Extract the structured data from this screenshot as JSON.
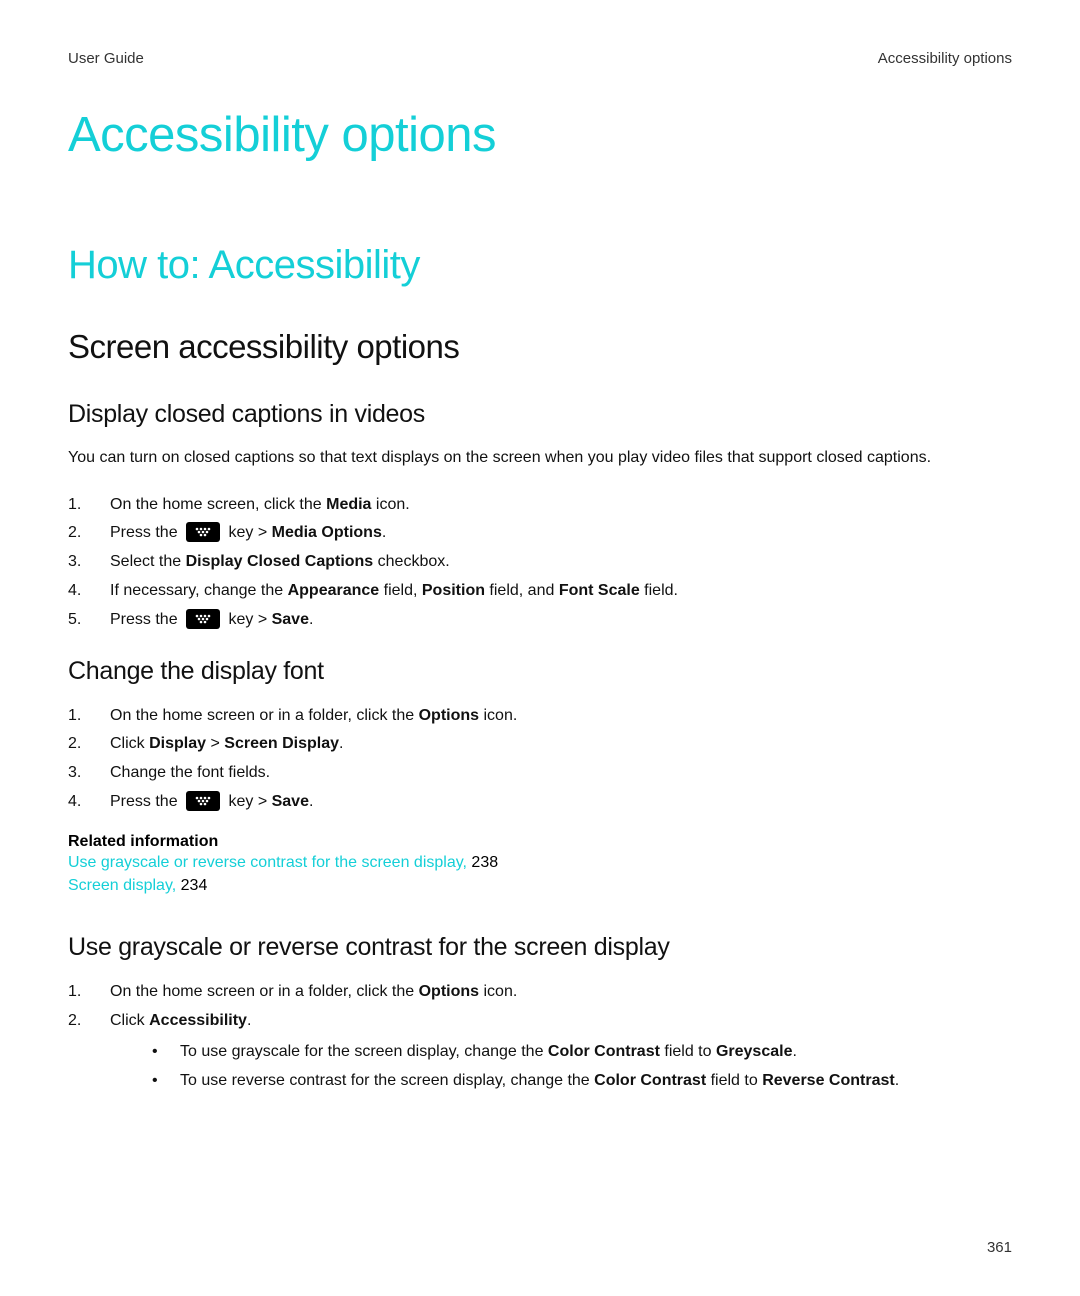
{
  "header": {
    "left": "User Guide",
    "right": "Accessibility options"
  },
  "page_title": "Accessibility options",
  "sections": {
    "howto": {
      "title": "How to: Accessibility",
      "screen_options": {
        "title": "Screen accessibility options",
        "closed_captions": {
          "title": "Display closed captions in videos",
          "intro": "You can turn on closed captions so that text displays on the screen when you play video files that support closed captions.",
          "steps": {
            "s1_a": "On the home screen, click the ",
            "s1_b": "Media",
            "s1_c": " icon.",
            "s2_a": "Press the ",
            "s2_b": " key > ",
            "s2_c": "Media Options",
            "s3_a": "Select the ",
            "s3_b": "Display Closed Captions",
            "s3_c": " checkbox.",
            "s4_a": "If necessary, change the ",
            "s4_b": "Appearance",
            "s4_c": " field, ",
            "s4_d": "Position",
            "s4_e": " field, and ",
            "s4_f": "Font Scale",
            "s4_g": " field.",
            "s5_a": "Press the ",
            "s5_b": " key > ",
            "s5_c": "Save"
          }
        },
        "display_font": {
          "title": "Change the display font",
          "steps": {
            "s1_a": "On the home screen or in a folder, click the ",
            "s1_b": "Options",
            "s1_c": " icon.",
            "s2_a": "Click ",
            "s2_b": "Display",
            "s2_c": " > ",
            "s2_d": "Screen Display",
            "s3": "Change the font fields.",
            "s4_a": "Press the ",
            "s4_b": " key > ",
            "s4_c": "Save"
          },
          "related": {
            "heading": "Related information",
            "link1_text": "Use grayscale or reverse contrast for the screen display,",
            "link1_page": " 238",
            "link2_text": "Screen display,",
            "link2_page": " 234"
          }
        },
        "grayscale": {
          "title": "Use grayscale or reverse contrast for the screen display",
          "steps": {
            "s1_a": "On the home screen or in a folder, click the ",
            "s1_b": "Options",
            "s1_c": " icon.",
            "s2_a": "Click ",
            "s2_b": "Accessibility"
          },
          "bullets": {
            "b1_a": "To use grayscale for the screen display, change the ",
            "b1_b": "Color Contrast",
            "b1_c": " field to ",
            "b1_d": "Greyscale",
            "b2_a": "To use reverse contrast for the screen display, change the ",
            "b2_b": "Color Contrast",
            "b2_c": " field to ",
            "b2_d": "Reverse Contrast"
          }
        }
      }
    }
  },
  "page_number": "361",
  "period": "."
}
